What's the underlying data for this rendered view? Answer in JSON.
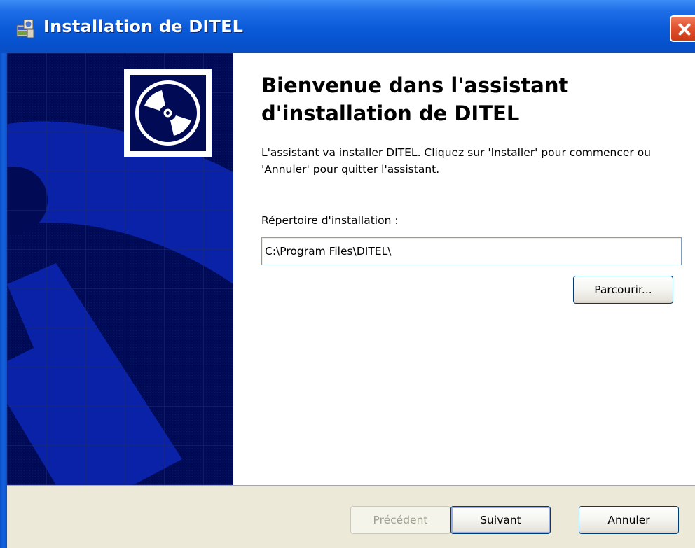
{
  "window": {
    "title": "Installation de DITEL",
    "icon": "installer-icon",
    "close_icon": "close-icon",
    "accent_color": "#0a5ad8",
    "close_color": "#e1532f"
  },
  "banner": {
    "logo_icon": "cd-disc-icon",
    "background_color": "#000a55",
    "shape_color": "#0a22a8"
  },
  "main": {
    "heading": "Bienvenue dans l'assistant d'installation de DITEL",
    "intro": "L'assistant va installer DITEL. Cliquez sur 'Installer' pour commencer ou 'Annuler' pour quitter l'assistant.",
    "install_dir_label": "Répertoire d'installation :",
    "install_dir_value": "C:\\Program Files\\DITEL\\",
    "browse_label": "Parcourir..."
  },
  "footer": {
    "prev_label": "Précédent",
    "next_label": "Suivant",
    "cancel_label": "Annuler"
  }
}
